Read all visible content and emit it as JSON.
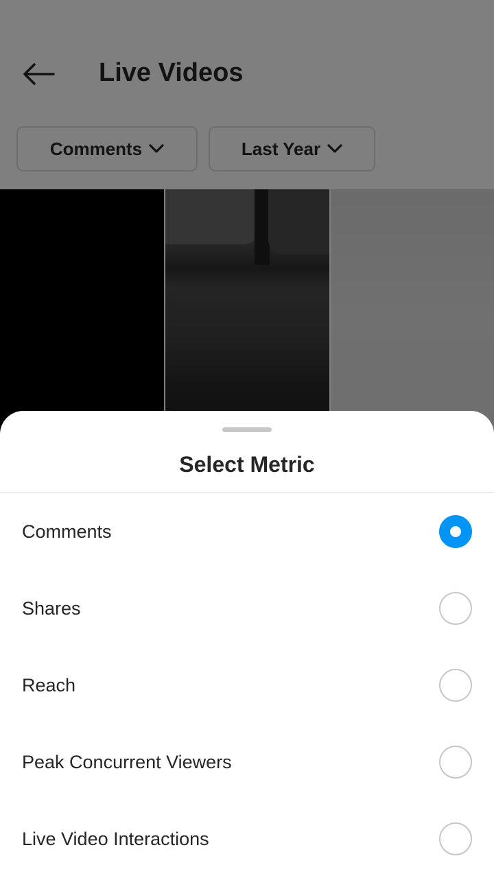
{
  "header": {
    "title": "Live Videos",
    "back_icon": "arrow-left-icon",
    "filters": [
      {
        "label": "Comments",
        "icon": "chevron-down-icon"
      },
      {
        "label": "Last Year",
        "icon": "chevron-down-icon"
      }
    ]
  },
  "sheet": {
    "title": "Select Metric",
    "options": [
      {
        "label": "Comments",
        "selected": true
      },
      {
        "label": "Shares",
        "selected": false
      },
      {
        "label": "Reach",
        "selected": false
      },
      {
        "label": "Peak Concurrent Viewers",
        "selected": false
      },
      {
        "label": "Live Video Interactions",
        "selected": false
      }
    ]
  },
  "colors": {
    "accent": "#0095f6",
    "text": "#262626",
    "overlay": "rgba(0,0,0,0.5)"
  }
}
